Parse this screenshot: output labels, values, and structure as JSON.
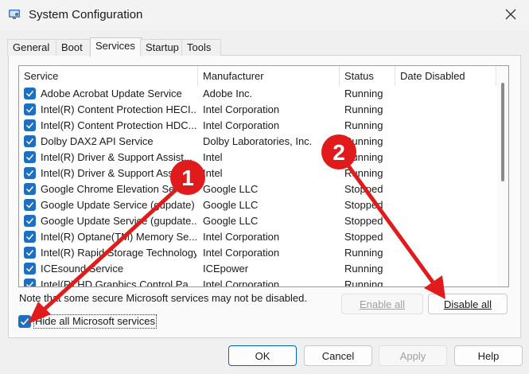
{
  "window": {
    "title": "System Configuration"
  },
  "icons": {
    "app": "system-config-icon",
    "close": "close-icon",
    "check": "checkmark-icon"
  },
  "tabs": [
    {
      "label": "General",
      "active": false
    },
    {
      "label": "Boot",
      "active": false
    },
    {
      "label": "Services",
      "active": true
    },
    {
      "label": "Startup",
      "active": false
    },
    {
      "label": "Tools",
      "active": false
    }
  ],
  "table": {
    "columns": [
      "Service",
      "Manufacturer",
      "Status",
      "Date Disabled"
    ],
    "rows": [
      {
        "service": "Adobe Acrobat Update Service",
        "manufacturer": "Adobe Inc.",
        "status": "Running",
        "date": ""
      },
      {
        "service": "Intel(R) Content Protection HECI...",
        "manufacturer": "Intel Corporation",
        "status": "Running",
        "date": ""
      },
      {
        "service": "Intel(R) Content Protection HDC...",
        "manufacturer": "Intel Corporation",
        "status": "Running",
        "date": ""
      },
      {
        "service": "Dolby DAX2 API Service",
        "manufacturer": "Dolby Laboratories, Inc.",
        "status": "Running",
        "date": ""
      },
      {
        "service": "Intel(R) Driver & Support Assist...",
        "manufacturer": "Intel",
        "status": "Running",
        "date": ""
      },
      {
        "service": "Intel(R) Driver & Support Assist...",
        "manufacturer": "Intel",
        "status": "Running",
        "date": ""
      },
      {
        "service": "Google Chrome Elevation Service...",
        "manufacturer": "Google LLC",
        "status": "Stopped",
        "date": ""
      },
      {
        "service": "Google Update Service (gupdate)",
        "manufacturer": "Google LLC",
        "status": "Stopped",
        "date": ""
      },
      {
        "service": "Google Update Service (gupdate...",
        "manufacturer": "Google LLC",
        "status": "Stopped",
        "date": ""
      },
      {
        "service": "Intel(R) Optane(TM) Memory Se...",
        "manufacturer": "Intel Corporation",
        "status": "Stopped",
        "date": ""
      },
      {
        "service": "Intel(R) Rapid Storage Technology",
        "manufacturer": "Intel Corporation",
        "status": "Running",
        "date": ""
      },
      {
        "service": "ICEsound Service",
        "manufacturer": "ICEpower",
        "status": "Running",
        "date": ""
      },
      {
        "service": "Intel(R) HD Graphics Control Pa...",
        "manufacturer": "Intel Corporation",
        "status": "Running",
        "date": ""
      }
    ]
  },
  "note": "Note that some secure Microsoft services may not be disabled.",
  "buttons": {
    "enable_all": "Enable all",
    "disable_all": "Disable all",
    "ok": "OK",
    "cancel": "Cancel",
    "apply": "Apply",
    "help": "Help"
  },
  "hide_ms": {
    "label": "Hide all Microsoft services",
    "checked": true
  },
  "annotations": [
    {
      "label": "1",
      "color": "#e11b1b"
    },
    {
      "label": "2",
      "color": "#e11b1b"
    }
  ],
  "colors": {
    "checkbox": "#1f6fbf",
    "primary_border": "#0067c0",
    "annotation": "#e11b1b"
  }
}
